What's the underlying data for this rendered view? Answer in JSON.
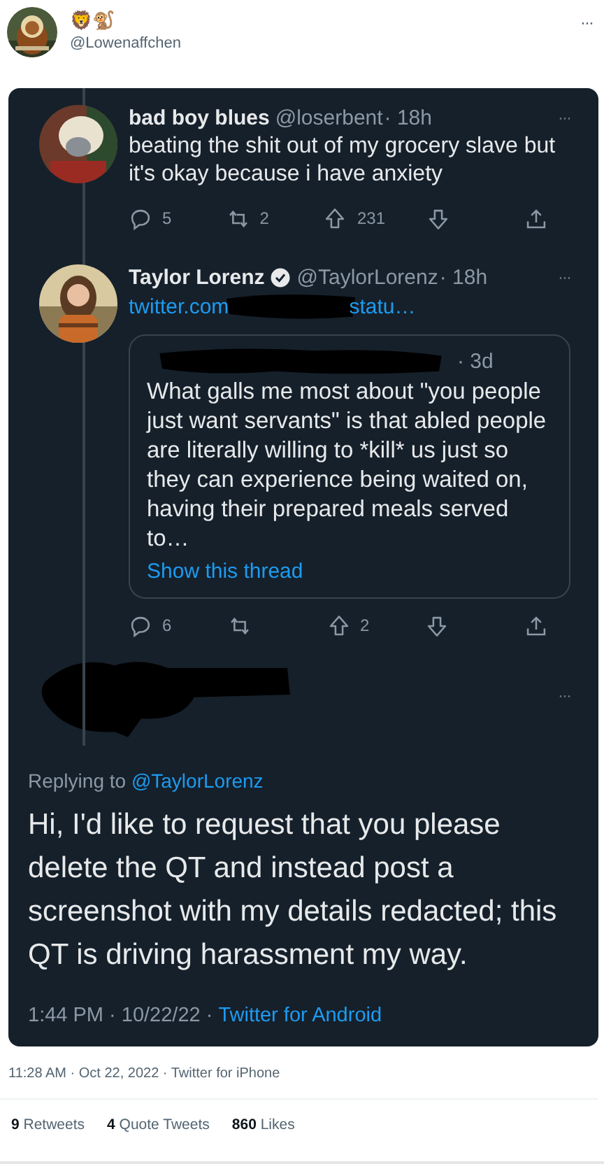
{
  "author": {
    "display_name": "🦁🐒",
    "handle": "@Lowenaffchen",
    "menu": "···"
  },
  "screenshot": {
    "tweets": [
      {
        "name": "bad boy blues",
        "handle": "@loserbent",
        "time": "· 18h",
        "verified": false,
        "menu": "···",
        "text": "beating the shit out of my grocery slave but it's okay because i have anxiety",
        "actions": [
          {
            "kind": "reply",
            "count": "5"
          },
          {
            "kind": "retweet",
            "count": "2"
          },
          {
            "kind": "upvote",
            "count": "231"
          },
          {
            "kind": "downvote"
          },
          {
            "kind": "share"
          }
        ]
      },
      {
        "name": "Taylor Lorenz",
        "handle": "@TaylorLorenz",
        "time": "· 18h",
        "verified": true,
        "menu": "···",
        "link_start": "twitter.com",
        "link_end": "statu…",
        "quote": {
          "time": "· 3d",
          "text": "What galls me most about \"you people just want servants\" is that abled people are literally willing to *kill* us just so they can experience being waited on, having their prepared meals served to…",
          "show_thread": "Show this thread"
        },
        "actions": [
          {
            "kind": "reply",
            "count": "6"
          },
          {
            "kind": "retweet"
          },
          {
            "kind": "upvote",
            "count": "2"
          },
          {
            "kind": "downvote"
          },
          {
            "kind": "share"
          }
        ]
      }
    ],
    "reply": {
      "menu": "···",
      "replying_label": "Replying to",
      "replying_handle": "@TaylorLorenz",
      "text": "Hi, I'd like to request that you please delete the QT and instead post a screenshot with my details redacted; this QT is driving harassment my way.",
      "time": "1:44 PM · 10/22/22 ·",
      "source": "Twitter for Android"
    }
  },
  "meta": "11:28 AM · Oct 22, 2022 · Twitter for iPhone",
  "stats": [
    {
      "count": "9",
      "label": "Retweets"
    },
    {
      "count": "4",
      "label": "Quote Tweets"
    },
    {
      "count": "860",
      "label": "Likes"
    }
  ]
}
